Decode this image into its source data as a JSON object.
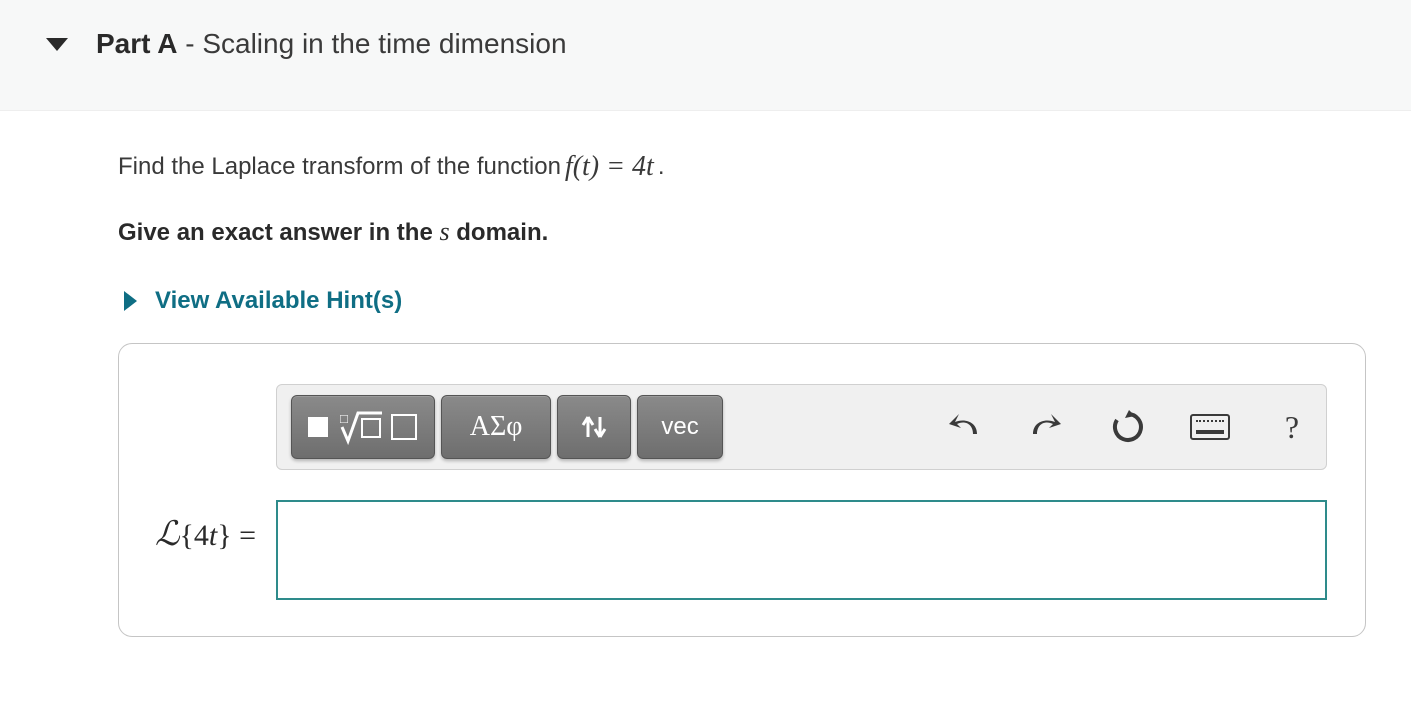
{
  "header": {
    "part_label": "Part A",
    "separator": " - ",
    "subtitle": "Scaling in the time dimension"
  },
  "prompt": {
    "lead": "Find the Laplace transform of the function ",
    "math": "f(t) = 4t",
    "tail": "."
  },
  "instruction": {
    "lead": "Give an exact answer in the ",
    "var": "s",
    "tail": " domain."
  },
  "hints": {
    "label": "View Available Hint(s)"
  },
  "toolbar": {
    "templates_label": "math templates",
    "greek_label": "ΑΣφ",
    "subsup_label": "sub/superscript",
    "vec_label": "vec",
    "undo_label": "undo",
    "redo_label": "redo",
    "reset_label": "reset",
    "keyboard_label": "keyboard",
    "help_label": "?"
  },
  "answer": {
    "prefix": "ℒ{4t} =",
    "value": "",
    "placeholder": ""
  }
}
